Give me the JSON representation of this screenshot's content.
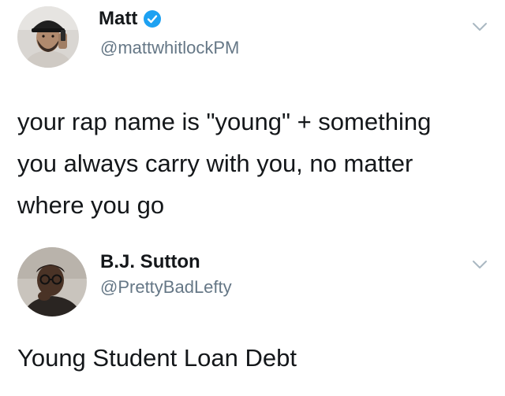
{
  "tweets": [
    {
      "author": {
        "name": "Matt",
        "handle": "@mattwhitlockPM",
        "verified": true
      },
      "text_lines": [
        "your rap name is \"young\" + something",
        "you always carry with you, no matter",
        "where you go"
      ],
      "icons": {
        "verified": "verified-badge-icon",
        "menu": "chevron-down-icon"
      }
    },
    {
      "author": {
        "name": "B.J. Sutton",
        "handle": "@PrettyBadLefty",
        "verified": false
      },
      "text_lines": [
        "Young Student Loan Debt"
      ],
      "icons": {
        "menu": "chevron-down-icon"
      }
    }
  ],
  "colors": {
    "text": "#14171a",
    "handle": "#657786",
    "verified": "#1da1f2",
    "chevron": "#aab8c2",
    "background": "#ffffff"
  }
}
